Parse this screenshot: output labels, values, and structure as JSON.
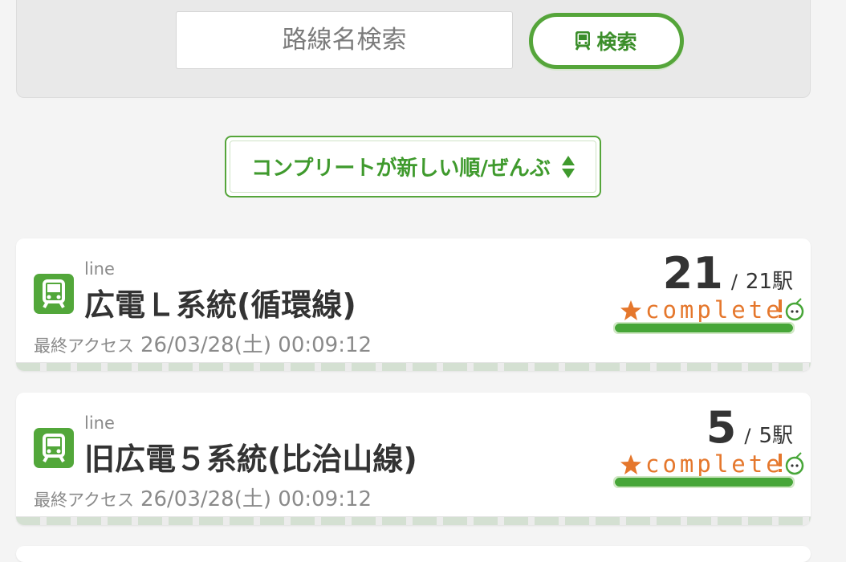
{
  "search": {
    "placeholder": "路線名検索",
    "button_label": "検索"
  },
  "sort": {
    "selected": "コンプリートが新しい順/ぜんぶ"
  },
  "colors": {
    "accent_green": "#55a53a",
    "complete_orange": "#e5772c"
  },
  "lines": [
    {
      "type": "line",
      "name": "広電Ｌ系統(循環線)",
      "last_access_label": "最終アクセス",
      "last_access": "26/03/28(土) 00:09:12",
      "count": "21",
      "total": "21駅",
      "complete_label": "complete",
      "progress": 1.0
    },
    {
      "type": "line",
      "name": "旧広電５系統(比治山線)",
      "last_access_label": "最終アクセス",
      "last_access": "26/03/28(土) 00:09:12",
      "count": "5",
      "total": "5駅",
      "complete_label": "complete",
      "progress": 1.0
    }
  ]
}
